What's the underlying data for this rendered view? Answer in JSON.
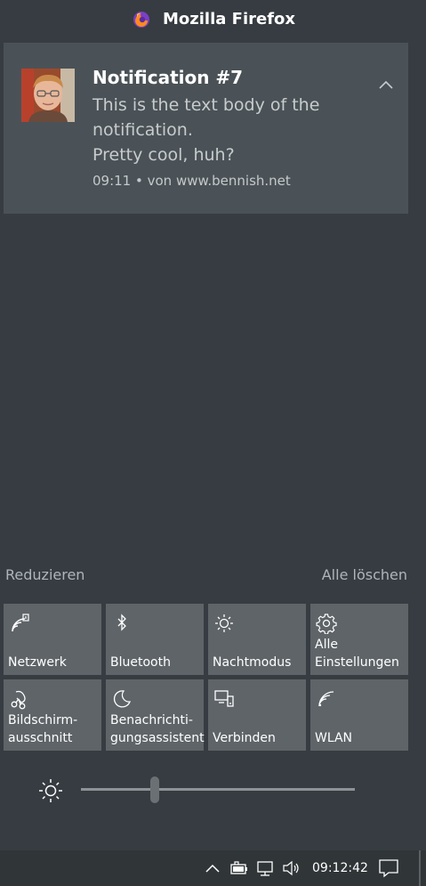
{
  "header": {
    "app_name": "Mozilla Firefox",
    "icon": "firefox-icon"
  },
  "notification": {
    "title": "Notification #7",
    "body_lines": [
      "This is the text body of the",
      "notification.",
      "Pretty cool, huh?"
    ],
    "meta": "09:11 • von www.bennish.net",
    "avatar": "avatar-photo",
    "collapse_icon": "chevron-up-icon"
  },
  "actions": {
    "reduce": "Reduzieren",
    "clear_all": "Alle löschen"
  },
  "quick_actions": [
    {
      "label": "Netzwerk",
      "icon": "network-icon"
    },
    {
      "label": "Bluetooth",
      "icon": "bluetooth-icon"
    },
    {
      "label": "Nachtmodus",
      "icon": "night-light-icon"
    },
    {
      "label": "Alle\nEinstellungen",
      "icon": "gear-icon"
    },
    {
      "label": "Bildschirm-\nausschnitt",
      "icon": "snip-icon"
    },
    {
      "label": "Benachrichti-\ngungsassistent",
      "icon": "moon-icon"
    },
    {
      "label": "Verbinden",
      "icon": "connect-icon"
    },
    {
      "label": "WLAN",
      "icon": "wifi-icon"
    }
  ],
  "brightness": {
    "icon": "sun-icon",
    "level": 0.27
  },
  "taskbar": {
    "clock": "09:12:42",
    "icons": [
      "chevron-up-icon",
      "battery-icon",
      "network-monitor-icon",
      "volume-icon",
      "action-center-icon"
    ]
  },
  "colors": {
    "background": "#363c41",
    "card": "#4a5257",
    "tile": "#5e6468",
    "taskbar": "#303538",
    "link": "#aeb5ba"
  }
}
